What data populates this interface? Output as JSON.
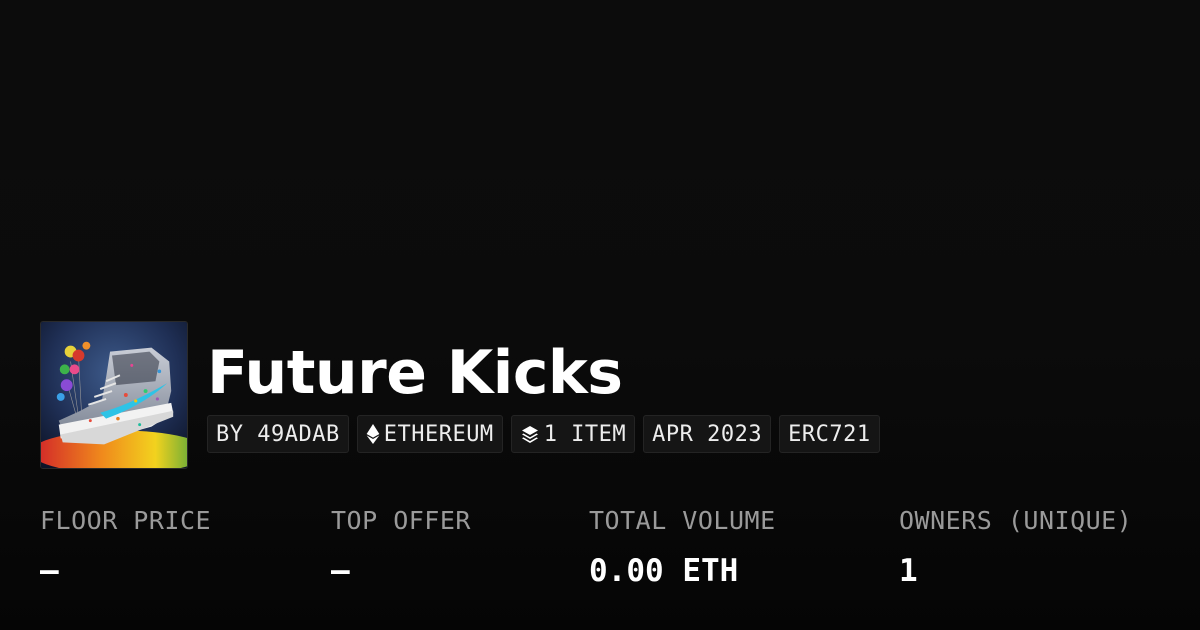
{
  "collection": {
    "title": "Future Kicks",
    "image_alt": "colorful high-top sneaker artwork",
    "tags": [
      {
        "icon": "",
        "text": "BY 49ADAB"
      },
      {
        "icon": "ethereum-icon",
        "text": "ETHEREUM"
      },
      {
        "icon": "layers-icon",
        "text": "1 ITEM"
      },
      {
        "icon": "",
        "text": "APR 2023"
      },
      {
        "icon": "",
        "text": "ERC721"
      }
    ]
  },
  "stats": [
    {
      "label": "FLOOR PRICE",
      "value": "–"
    },
    {
      "label": "TOP OFFER",
      "value": "–"
    },
    {
      "label": "TOTAL VOLUME",
      "value": "0.00 ETH"
    },
    {
      "label": "OWNERS (UNIQUE)",
      "value": "1"
    }
  ]
}
